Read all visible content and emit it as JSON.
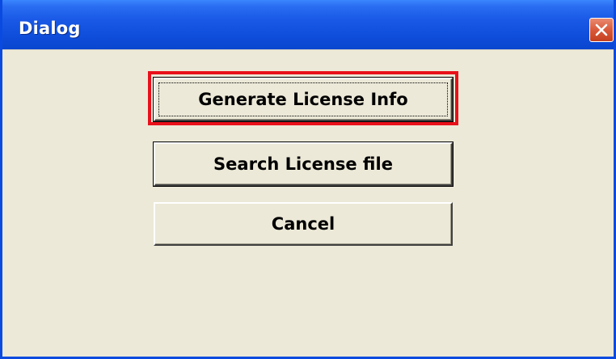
{
  "window": {
    "title": "Dialog",
    "close_icon": "close-icon"
  },
  "buttons": {
    "generate": "Generate License Info",
    "search": "Search License file",
    "cancel": "Cancel"
  },
  "colors": {
    "titlebar": "#0f4fdc",
    "client_bg": "#ece9d8",
    "highlight": "#e8101a",
    "close_button": "#d9593b"
  }
}
